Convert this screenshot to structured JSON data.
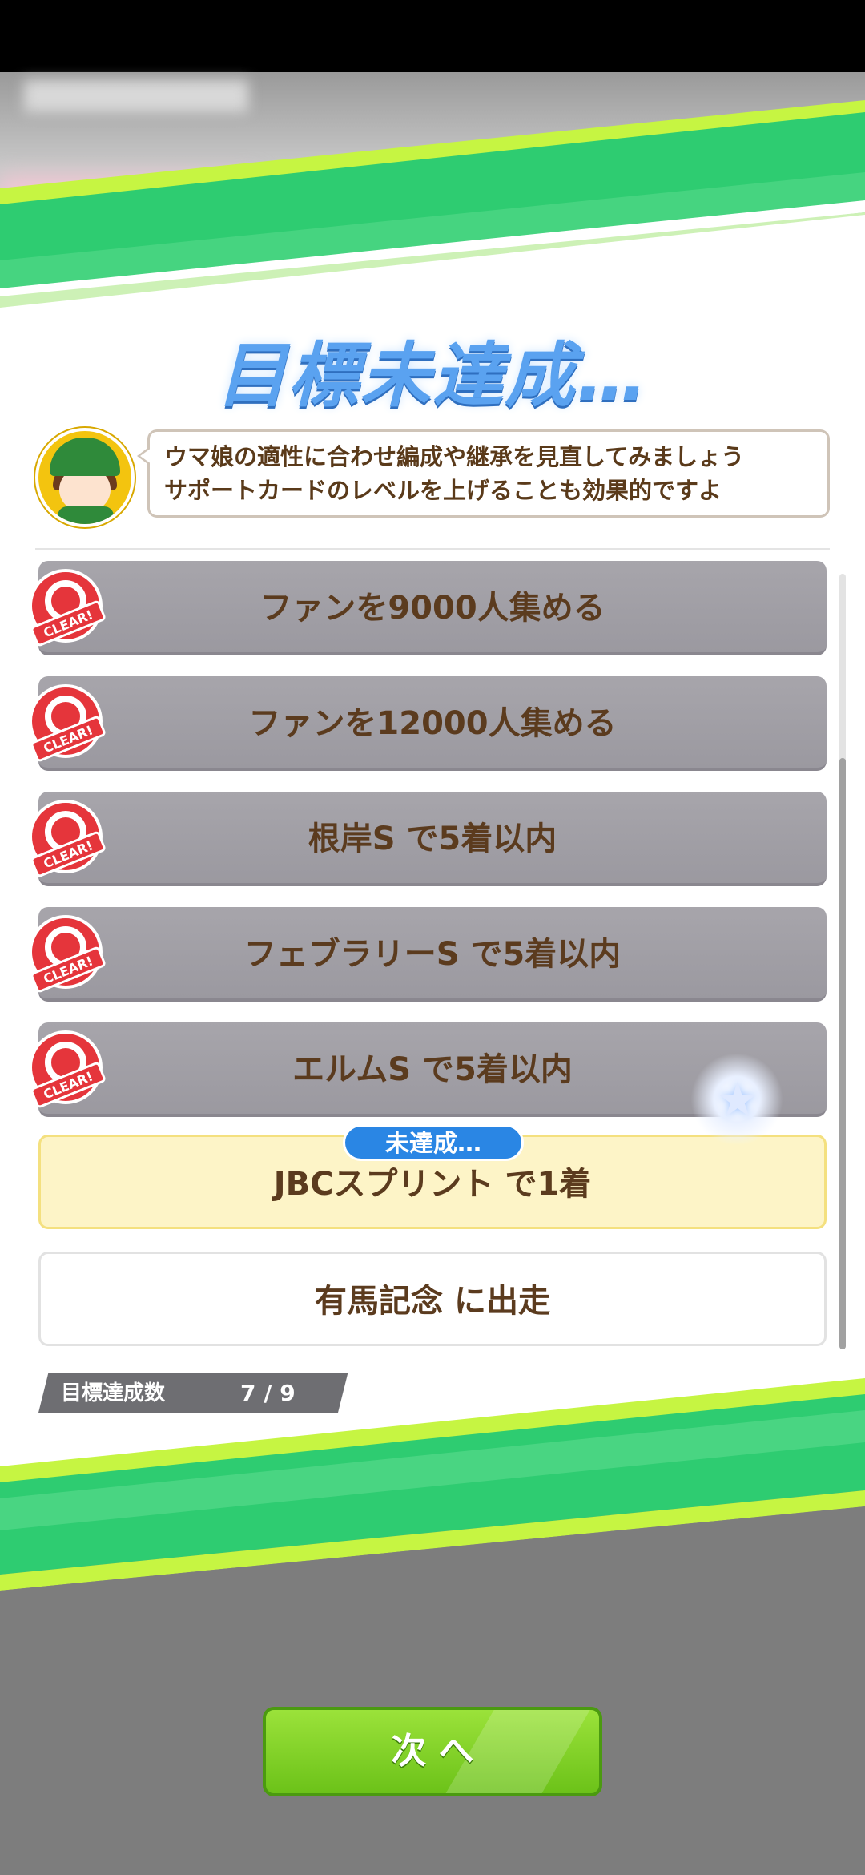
{
  "header": {
    "title": "目標未達成…"
  },
  "advice": {
    "line1": "ウマ娘の適性に合わせ編成や継承を見直してみましょう",
    "line2": "サポートカードのレベルを上げることも効果的ですよ"
  },
  "goals": [
    {
      "text": "ファンを9000人集める",
      "status": "cleared"
    },
    {
      "text": "ファンを12000人集める",
      "status": "cleared"
    },
    {
      "text": "根岸S で5着以内",
      "status": "cleared"
    },
    {
      "text": "フェブラリーS で5着以内",
      "status": "cleared"
    },
    {
      "text": "エルムS で5着以内",
      "status": "cleared"
    },
    {
      "text": "JBCスプリント で1着",
      "status": "pending"
    },
    {
      "text": "有馬記念 に出走",
      "status": "normal"
    }
  ],
  "pending_badge": "未達成…",
  "stamp_text": "CLEAR!",
  "goal_count": {
    "label": "目標達成数",
    "value": "7 / 9"
  },
  "next_button": "次 へ",
  "colors": {
    "green": "#2ecc71",
    "lime": "#c6f542",
    "title_blue": "#5aa2f0",
    "stamp_red": "#e5353b",
    "badge_blue": "#2a86e4"
  }
}
